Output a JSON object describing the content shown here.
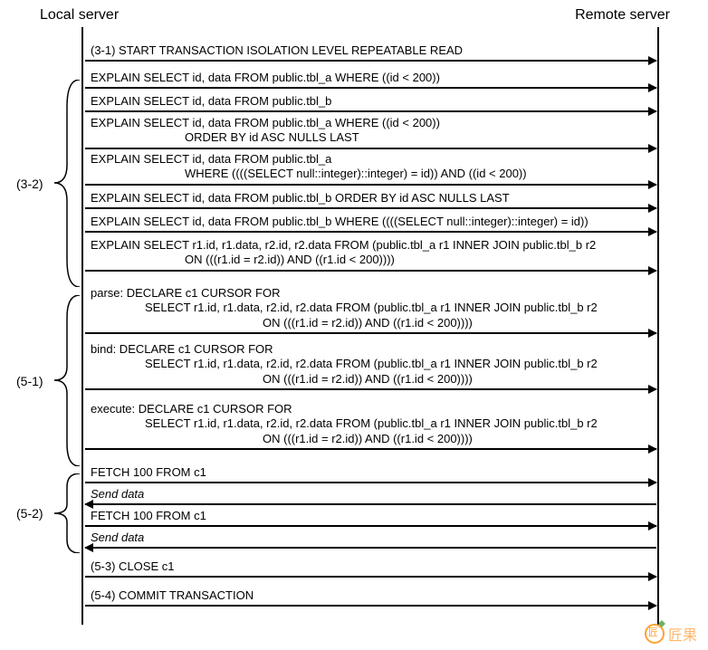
{
  "headers": {
    "local": "Local server",
    "remote": "Remote server"
  },
  "groups": {
    "g32": "(3-2)",
    "g51": "(5-1)",
    "g52": "(5-2)"
  },
  "messages": {
    "m31": "(3-1) START TRANSACTION ISOLATION LEVEL REPEATABLE READ",
    "m32a": "EXPLAIN SELECT id, data FROM public.tbl_a WHERE ((id < 200))",
    "m32b": "EXPLAIN SELECT id, data FROM public.tbl_b",
    "m32c_l1": "EXPLAIN SELECT id, data FROM public.tbl_a WHERE ((id < 200))",
    "m32c_l2": "ORDER BY id ASC NULLS LAST",
    "m32d_l1": "EXPLAIN SELECT id, data FROM public.tbl_a",
    "m32d_l2": "WHERE ((((SELECT null::integer)::integer) = id)) AND ((id < 200))",
    "m32e": "EXPLAIN SELECT id, data FROM public.tbl_b ORDER BY id ASC NULLS LAST",
    "m32f": "EXPLAIN SELECT id, data FROM public.tbl_b WHERE ((((SELECT null::integer)::integer) = id))",
    "m32g_l1": "EXPLAIN SELECT r1.id, r1.data, r2.id, r2.data FROM (public.tbl_a r1 INNER JOIN public.tbl_b r2",
    "m32g_l2": "ON (((r1.id = r2.id)) AND ((r1.id < 200))))",
    "m51a_l1": "parse: DECLARE c1 CURSOR FOR",
    "m51a_l2": "SELECT r1.id, r1.data, r2.id, r2.data FROM (public.tbl_a r1 INNER JOIN public.tbl_b r2",
    "m51a_l3": "ON (((r1.id = r2.id)) AND ((r1.id < 200))))",
    "m51b_l1": "bind: DECLARE c1 CURSOR FOR",
    "m51b_l2": "SELECT r1.id, r1.data, r2.id, r2.data FROM (public.tbl_a r1 INNER JOIN public.tbl_b r2",
    "m51b_l3": "ON (((r1.id = r2.id)) AND ((r1.id < 200))))",
    "m51c_l1": "execute: DECLARE c1 CURSOR FOR",
    "m51c_l2": "SELECT r1.id, r1.data, r2.id, r2.data FROM (public.tbl_a r1 INNER JOIN public.tbl_b r2",
    "m51c_l3": "ON (((r1.id = r2.id)) AND ((r1.id < 200))))",
    "m52a": "FETCH 100 FROM c1",
    "m52b": "Send data",
    "m52c": "FETCH 100 FROM c1",
    "m52d": "Send data",
    "m53": "(5-3)  CLOSE c1",
    "m54": "(5-4)  COMMIT TRANSACTION"
  },
  "watermark": "匠果"
}
